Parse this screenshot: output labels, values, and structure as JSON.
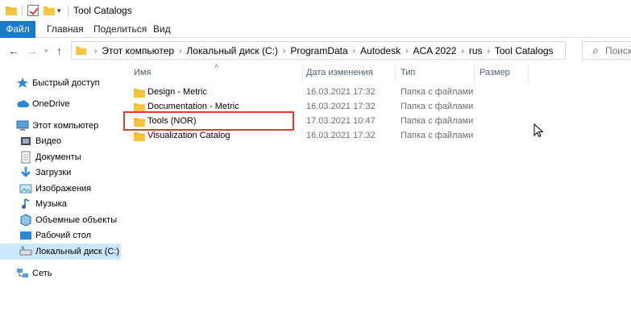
{
  "window": {
    "title": "Tool Catalogs"
  },
  "ribbon": {
    "tabs": [
      "Файл",
      "Главная",
      "Поделиться",
      "Вид"
    ],
    "accent": "#1979ca"
  },
  "address": {
    "crumbs": [
      "Этот компьютер",
      "Локальный диск (C:)",
      "ProgramData",
      "Autodesk",
      "ACA 2022",
      "rus",
      "Tool Catalogs"
    ],
    "search_placeholder": "Поиск"
  },
  "nav": {
    "items": [
      {
        "label": "Быстрый доступ",
        "icon": "star-icon"
      },
      {
        "label": "OneDrive",
        "icon": "cloud-icon"
      },
      {
        "label": "Этот компьютер",
        "icon": "computer-icon"
      },
      {
        "label": "Видео",
        "icon": "video-icon"
      },
      {
        "label": "Документы",
        "icon": "documents-icon"
      },
      {
        "label": "Загрузки",
        "icon": "download-icon"
      },
      {
        "label": "Изображения",
        "icon": "pictures-icon"
      },
      {
        "label": "Музыка",
        "icon": "music-icon"
      },
      {
        "label": "Объемные объекты",
        "icon": "3d-objects-icon"
      },
      {
        "label": "Рабочий стол",
        "icon": "desktop-icon"
      },
      {
        "label": "Локальный диск (C:)",
        "icon": "drive-icon"
      },
      {
        "label": "Сеть",
        "icon": "network-icon"
      }
    ]
  },
  "columns": {
    "name": "Имя",
    "date": "Дата изменения",
    "type": "Тип",
    "size": "Размер"
  },
  "files": [
    {
      "name": "Design - Metric",
      "date": "16.03.2021 17:32",
      "type": "Папка с файлами"
    },
    {
      "name": "Documentation - Metric",
      "date": "16.03.2021 17:32",
      "type": "Папка с файлами"
    },
    {
      "name": "Tools (NOR)",
      "date": "17.03.2021 10:47",
      "type": "Папка с файлами"
    },
    {
      "name": "Visualization Catalog",
      "date": "16.03.2021 17:32",
      "type": "Папка с файлами"
    }
  ],
  "colors": {
    "folder": "#f5c542",
    "highlight": "#e03a2f",
    "selected_nav": "#cce8ff"
  }
}
